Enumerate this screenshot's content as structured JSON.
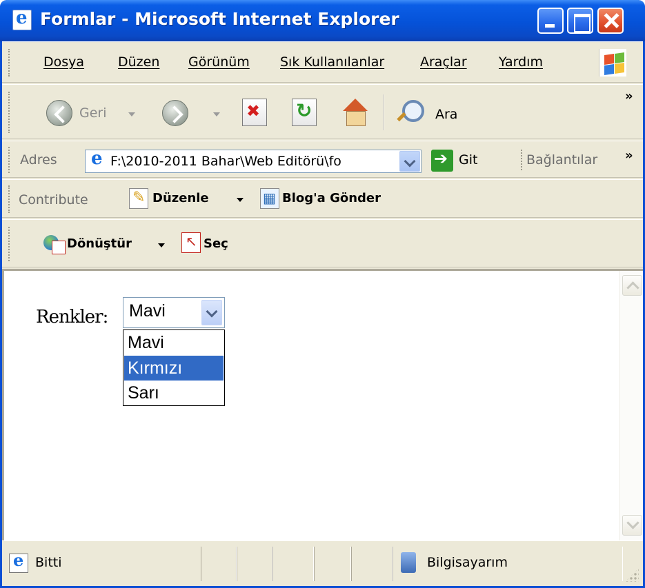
{
  "window": {
    "title": "Formlar - Microsoft Internet Explorer"
  },
  "menu": [
    "Dosya",
    "Düzen",
    "Görünüm",
    "Sık Kullanılanlar",
    "Araçlar",
    "Yardım"
  ],
  "toolbar": {
    "back_label": "Geri",
    "search_label": "Ara",
    "more_glyph": "»"
  },
  "address": {
    "label": "Adres",
    "value": "F:\\2010-2011 Bahar\\Web Editörü\\fo",
    "go_label": "Git",
    "links_label": "Bağlantılar",
    "more_glyph": "»"
  },
  "contribute": {
    "label": "Contribute",
    "edit_label": "Düzenle",
    "blog_label": "Blog'a Gönder"
  },
  "pdf": {
    "convert_label": "Dönüştür",
    "select_label": "Seç"
  },
  "page": {
    "label": "Renkler:",
    "select_value": "Mavi",
    "options": [
      "Mavi",
      "Kırmızı",
      "Sarı"
    ],
    "highlighted_option": "Kırmızı"
  },
  "status": {
    "text": "Bitti",
    "zone": "Bilgisayarım"
  },
  "colors": {
    "title_blue": "#0552d8",
    "chrome": "#ece9d8",
    "highlight": "#316ac5",
    "close_red": "#e1502c"
  },
  "icons": [
    "ie-icon",
    "minimize-icon",
    "maximize-icon",
    "close-icon",
    "windows-logo-icon",
    "back-arrow-icon",
    "forward-arrow-icon",
    "stop-icon",
    "refresh-icon",
    "home-icon",
    "search-icon",
    "go-arrow-icon",
    "edit-page-icon",
    "blog-icon",
    "pdf-convert-icon",
    "pdf-select-icon",
    "computer-zone-icon"
  ]
}
